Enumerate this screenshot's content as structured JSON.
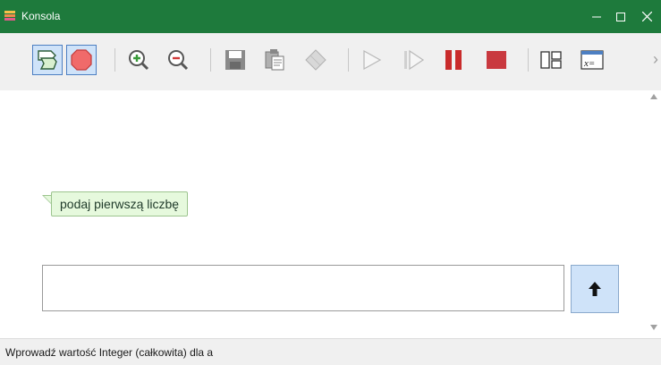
{
  "window": {
    "title": "Konsola",
    "controls": [
      "minimize",
      "maximize",
      "close"
    ],
    "titlebar_color": "#1e7a3c"
  },
  "toolbar": {
    "buttons": [
      {
        "icon": "flow-step-icon",
        "active": true
      },
      {
        "icon": "stop-octagon-icon",
        "active": true
      },
      {
        "icon": "zoom-in-icon",
        "active": false
      },
      {
        "icon": "zoom-out-icon",
        "active": false
      },
      {
        "icon": "save-icon",
        "active": false
      },
      {
        "icon": "copy-icon",
        "active": false
      },
      {
        "icon": "eraser-icon",
        "active": false
      },
      {
        "icon": "play-icon",
        "active": false
      },
      {
        "icon": "step-icon",
        "active": false
      },
      {
        "icon": "pause-icon",
        "active": false
      },
      {
        "icon": "stop-icon",
        "active": false
      },
      {
        "icon": "layout-icon",
        "active": false
      },
      {
        "icon": "variables-icon",
        "active": false,
        "label": "x="
      }
    ],
    "overflow_icon": "chevron-right-icon"
  },
  "console": {
    "prompt_message": "podaj pierwszą liczbę",
    "input_value": "",
    "submit_icon": "arrow-up-icon"
  },
  "status": {
    "text": "Wprowadź wartość Integer (całkowita) dla a"
  }
}
